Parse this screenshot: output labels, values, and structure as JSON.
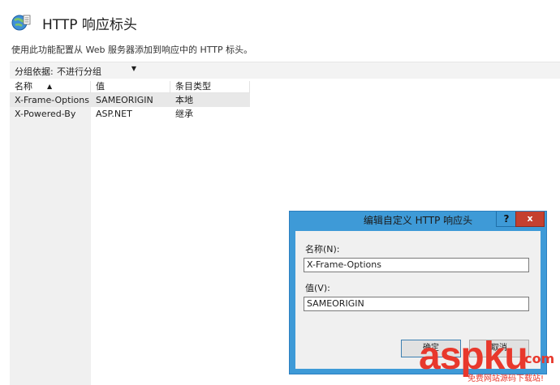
{
  "header": {
    "title": "HTTP 响应标头",
    "description": "使用此功能配置从 Web 服务器添加到响应中的 HTTP 标头。"
  },
  "toolbar": {
    "group_label": "分组依据:",
    "group_value": "不进行分组"
  },
  "table": {
    "columns": [
      "名称",
      "值",
      "条目类型"
    ],
    "rows": [
      {
        "name": "X-Frame-Options",
        "value": "SAMEORIGIN",
        "type": "本地"
      },
      {
        "name": "X-Powered-By",
        "value": "ASP.NET",
        "type": "继承"
      }
    ]
  },
  "dialog": {
    "title": "编辑自定义 HTTP 响应头",
    "help": "?",
    "close": "x",
    "name_label": "名称(N):",
    "name_value": "X-Frame-Options",
    "value_label": "值(V):",
    "value_value": "SAMEORIGIN",
    "ok_label": "确定",
    "cancel_label": "取消"
  },
  "watermark": {
    "brand": "aspku",
    "tld": ".com",
    "tagline": "免费网站源码下载站!"
  },
  "colors": {
    "dialog_frame": "#3e9ad7",
    "close_button": "#c5402f",
    "selection": "#e8e8e8",
    "watermark": "#e8382c"
  }
}
